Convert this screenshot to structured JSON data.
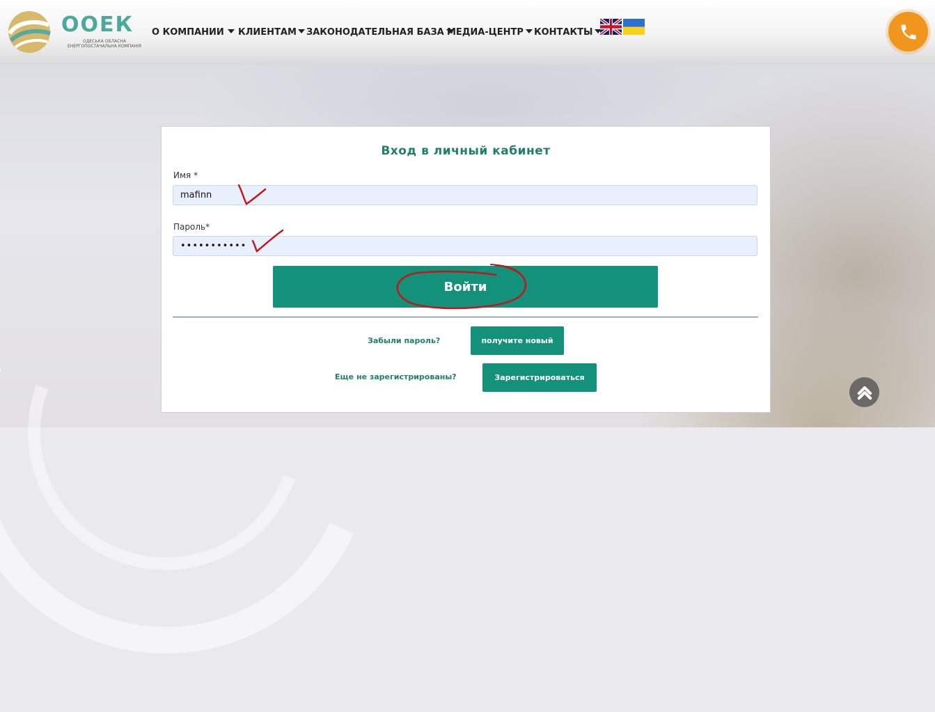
{
  "logo": {
    "title": "ООЕК",
    "subtitle_line1": "ОДЕСЬКА ОБЛАСНА",
    "subtitle_line2": "ЕНЕРГОПОСТАЧАЛЬНА КОМПАНІЯ"
  },
  "nav": {
    "items": [
      {
        "label": "О КОМПАНИИ"
      },
      {
        "label": "КЛИЕНТАМ"
      },
      {
        "label": "ЗАКОНОДАТЕЛЬНАЯ БАЗА"
      },
      {
        "label": "МЕДИА-ЦЕНТР"
      },
      {
        "label": "КОНТАКТЫ"
      }
    ],
    "flags": [
      "uk-flag-icon",
      "ukraine-flag-icon"
    ]
  },
  "phone": {
    "icon": "phone-icon",
    "color": "#f0961f"
  },
  "login": {
    "title": "Вход в личный кабинет",
    "name_label": "Имя *",
    "name_value": "mafinn",
    "password_label": "Пароль*",
    "password_value": "•••••••••••",
    "submit_label": "Войти",
    "forgot_text": "Забыли пароль?",
    "get_new_label": "получите новый",
    "not_registered_text": "Еще не зарегистрированы?",
    "register_label": "Зарегистрироваться"
  },
  "colors": {
    "accent": "#14917a",
    "title": "#1e7f6a",
    "annotation": "#c0181a"
  },
  "scroll_top": {
    "icon": "chevron-up-icon"
  }
}
